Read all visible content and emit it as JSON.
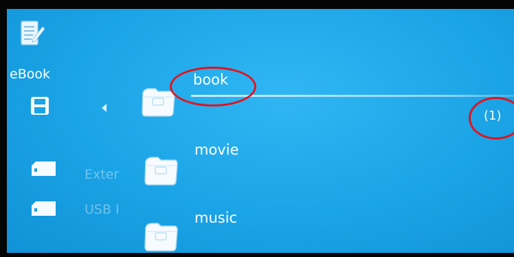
{
  "app": {
    "title": "eBook",
    "icon": "ebook-pencil-icon"
  },
  "sidebar": {
    "items": [
      {
        "label": "",
        "icon": "floppy-disk-icon"
      },
      {
        "label": "Exter",
        "icon": "sd-card-icon"
      },
      {
        "label": "USB I",
        "icon": "sd-card-icon"
      }
    ]
  },
  "folders": [
    {
      "label": "book",
      "icon": "folder-icon",
      "selected": true
    },
    {
      "label": "movie",
      "icon": "folder-icon",
      "selected": false
    },
    {
      "label": "music",
      "icon": "folder-icon",
      "selected": false
    }
  ],
  "selection": {
    "count": "(1)"
  },
  "colors": {
    "background": "#1aa3e6",
    "annotation": "#e0141e",
    "text": "#ffffff"
  }
}
